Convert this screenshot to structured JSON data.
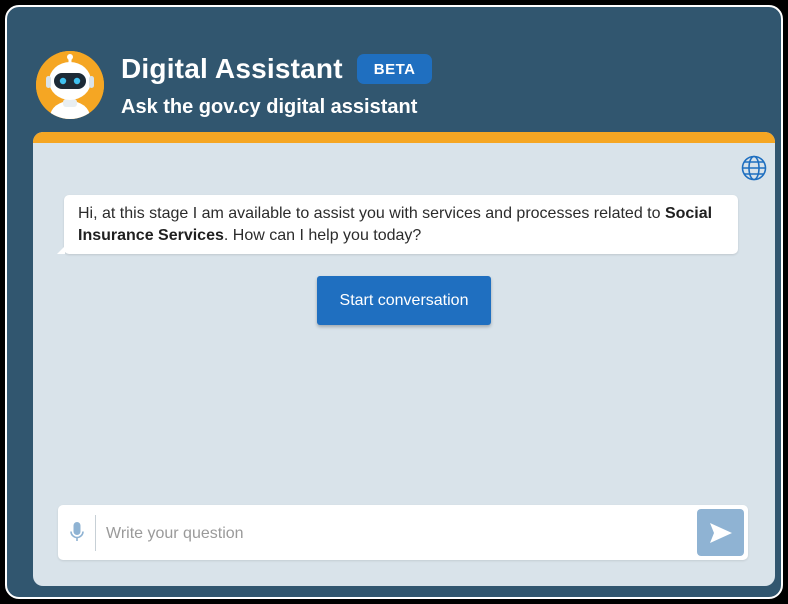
{
  "header": {
    "title": "Digital Assistant",
    "badge": "BETA",
    "subtitle": "Ask the gov.cy digital assistant"
  },
  "chat": {
    "message": {
      "prefix": "Hi, at this stage I am available to assist you with services and processes related to ",
      "highlight": "Social Insurance Services",
      "suffix": ". How can I help you today?"
    },
    "start_button": "Start conversation"
  },
  "composer": {
    "placeholder": "Write your question"
  },
  "icons": {
    "avatar": "robot-avatar-icon",
    "language": "globe-icon",
    "voice": "microphone-icon",
    "send": "send-icon"
  },
  "colors": {
    "background": "#31566f",
    "accent": "#f5a623",
    "primary": "#1f6fc0",
    "panel": "#d9e3ea",
    "send_disabled": "#8fb3d3"
  }
}
